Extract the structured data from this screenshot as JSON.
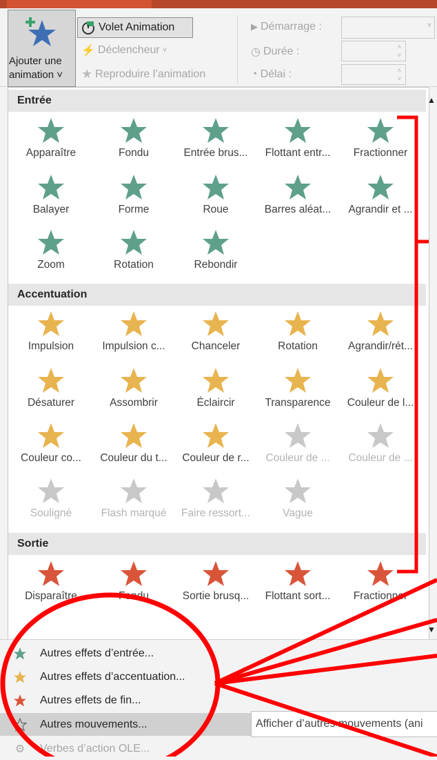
{
  "ribbon": {
    "add_animation_line1": "Ajouter une",
    "add_animation_line2": "animation",
    "animation_pane": "Volet Animation",
    "trigger": "Déclencheur",
    "animation_painter": "Reproduire l’animation",
    "start_label": "Démarrage :",
    "duration_label": "Durée :",
    "delay_label": "Délai :"
  },
  "sections": {
    "entrance": "Entrée",
    "emphasis": "Accentuation",
    "exit": "Sortie"
  },
  "entrance_items": [
    "Apparaître",
    "Fondu",
    "Entrée brus...",
    "Flottant entr...",
    "Fractionner",
    "Balayer",
    "Forme",
    "Roue",
    "Barres aléat...",
    "Agrandir et ...",
    "Zoom",
    "Rotation",
    "Rebondir"
  ],
  "emphasis_items": [
    "Impulsion",
    "Impulsion c...",
    "Chanceler",
    "Rotation",
    "Agrandir/rét...",
    "Désaturer",
    "Assombrir",
    "Éclaircir",
    "Transparence",
    "Couleur de l...",
    "Couleur co...",
    "Couleur du t...",
    "Couleur de r...",
    "Couleur de ...",
    "Couleur de ...",
    "Souligné",
    "Flash marqué",
    "Faire ressort...",
    "Vague"
  ],
  "exit_items": [
    "Disparaître",
    "Fondu",
    "Sortie brusq...",
    "Flottant sort...",
    "Fractionner"
  ],
  "menu": {
    "more_entrance": "Autres effets d’entrée...",
    "more_emphasis": "Autres effets d’accentuation...",
    "more_exit": "Autres effets de fin...",
    "more_motion": "Autres mouvements...",
    "ole": "Verbes d’action OLE..."
  },
  "tooltip": "Afficher d’autres mouvements (ani",
  "colors": {
    "entrance": "#5fa08a",
    "emphasis": "#e8b44f",
    "exit": "#d9553a",
    "annotation": "#ff0000"
  }
}
